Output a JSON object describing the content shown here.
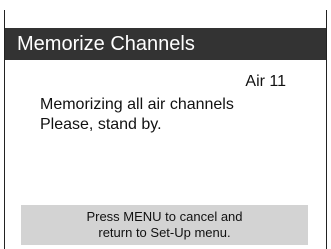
{
  "dialog": {
    "title": "Memorize Channels",
    "channel_status": "Air 11",
    "message_line1": "Memorizing all air channels",
    "message_line2": "Please, stand by.",
    "footer_line1": "Press MENU to cancel and",
    "footer_line2": "return to Set-Up menu."
  },
  "colors": {
    "title_bar": "#333333",
    "footer_bg": "#d3d3d3",
    "background": "#ffffff"
  }
}
